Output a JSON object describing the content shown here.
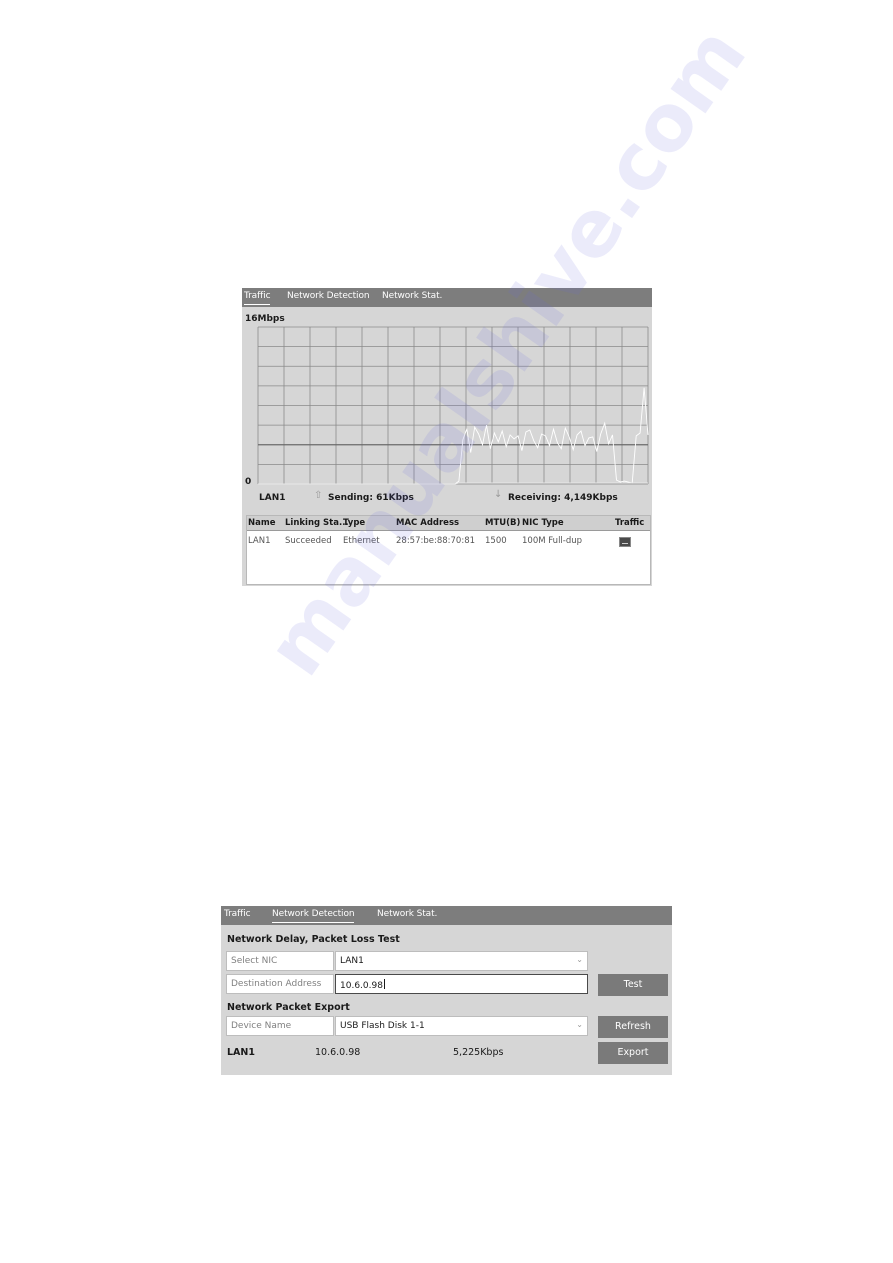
{
  "traffic_panel": {
    "tabs": [
      {
        "label": "Traffic",
        "active": true
      },
      {
        "label": "Network Detection",
        "active": false
      },
      {
        "label": "Network Stat.",
        "active": false
      }
    ],
    "legend": {
      "nic": "LAN1",
      "sending_icon": "up-arrow-icon",
      "sending": "Sending: 61Kbps",
      "receiving_icon": "down-arrow-icon",
      "receiving": "Receiving: 4,149Kbps"
    },
    "table": {
      "columns": [
        "Name",
        "Linking Sta...",
        "Type",
        "MAC Address",
        "MTU(B)",
        "NIC Type",
        "Traffic"
      ],
      "rows": [
        {
          "name": "LAN1",
          "linking_status": "Succeeded",
          "type": "Ethernet",
          "mac": "28:57:be:88:70:81",
          "mtu": "1500",
          "nic_type": "100M Full-dup",
          "traffic_icon": "traffic-graph-icon"
        }
      ]
    }
  },
  "chart_data": {
    "type": "line",
    "title": "",
    "ylabel_top": "16Mbps",
    "ylabel_bottom": "0",
    "ylim": [
      0,
      16
    ],
    "y_unit": "Mbps",
    "grid": true,
    "x_divisions": 15,
    "y_divisions": 8,
    "series": [
      {
        "name": "Receiving",
        "color": "#ffffff",
        "values": [
          0,
          0,
          0,
          0,
          0,
          0,
          0,
          0,
          0,
          0,
          0,
          0,
          0,
          0,
          0,
          0,
          0,
          0,
          0,
          0,
          0,
          0,
          0,
          0,
          0,
          0,
          0,
          0,
          0,
          0,
          0,
          0,
          0,
          0,
          0,
          0,
          0,
          0,
          0,
          0,
          0,
          0,
          0,
          0,
          0,
          0,
          0,
          0,
          0,
          0,
          0,
          0.3,
          4.5,
          5.6,
          3.2,
          5.8,
          5.1,
          4.0,
          6.0,
          3.6,
          5.2,
          4.3,
          5.4,
          3.8,
          5.0,
          4.6,
          4.9,
          3.4,
          5.3,
          5.5,
          4.4,
          3.7,
          5.1,
          4.9,
          3.9,
          5.6,
          4.2,
          3.6,
          5.7,
          4.8,
          3.5,
          5.0,
          5.4,
          3.9,
          4.7,
          4.8,
          3.3,
          5.1,
          6.2,
          4.1,
          5.0,
          0.4,
          0.2,
          0.3,
          0.2,
          0.1,
          4.9,
          5.2,
          9.8,
          5.0
        ]
      },
      {
        "name": "Sending",
        "color": "#e8e8e8",
        "values": [
          0,
          0,
          0,
          0,
          0,
          0,
          0,
          0,
          0,
          0,
          0,
          0,
          0,
          0,
          0,
          0,
          0,
          0,
          0,
          0,
          0,
          0,
          0,
          0,
          0,
          0,
          0,
          0,
          0,
          0,
          0,
          0,
          0,
          0,
          0,
          0,
          0,
          0,
          0,
          0,
          0,
          0,
          0,
          0,
          0,
          0,
          0,
          0,
          0,
          0,
          0,
          0.1,
          0.1,
          0.1,
          0.1,
          0.1,
          0.1,
          0.1,
          0.1,
          0.1,
          0.1,
          0.1,
          0.1,
          0.1,
          0.1,
          0.1,
          0.1,
          0.1,
          0.1,
          0.1,
          0.1,
          0.1,
          0.1,
          0.1,
          0.1,
          0.1,
          0.1,
          0.1,
          0.1,
          0.1,
          0.1,
          0.1,
          0.1,
          0.1,
          0.1,
          0.1,
          0.1,
          0.1,
          0.1,
          0.1,
          0.1,
          0.1,
          0.1,
          0.1,
          0.1,
          0.1,
          0.1,
          0.1,
          0.1,
          0.1
        ]
      }
    ]
  },
  "detection_panel": {
    "tabs": [
      {
        "label": "Traffic",
        "active": false
      },
      {
        "label": "Network Detection",
        "active": true
      },
      {
        "label": "Network Stat.",
        "active": false
      }
    ],
    "delay_section": {
      "title": "Network Delay, Packet Loss Test",
      "select_nic_label": "Select NIC",
      "select_nic_value": "LAN1",
      "destination_label": "Destination Address",
      "destination_value": "10.6.0.98",
      "test_button": "Test"
    },
    "export_section": {
      "title": "Network Packet Export",
      "device_label": "Device Name",
      "device_value": "USB Flash Disk 1-1",
      "refresh_button": "Refresh",
      "export_button": "Export",
      "status_nic": "LAN1",
      "status_address": "10.6.0.98",
      "status_rate": "5,225Kbps"
    }
  },
  "watermark": "manualshive.com",
  "colors": {
    "tab_bar": "#7d7d7d",
    "panel_bg": "#d6d6d6",
    "button_bg": "#7a7a7a",
    "grid_line": "#8a8a8a",
    "watermark": "#6a6ae0"
  }
}
